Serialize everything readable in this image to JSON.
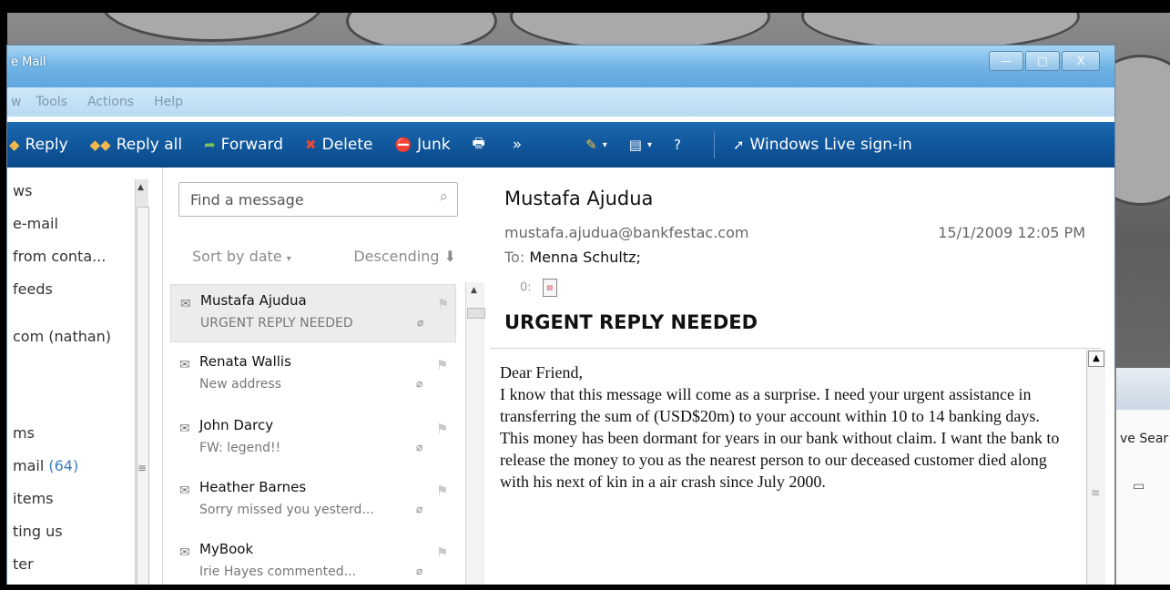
{
  "window": {
    "title": "e Mail",
    "controls": {
      "minimize": "—",
      "maximize": "□",
      "close": "X"
    }
  },
  "menu": [
    "w",
    "Tools",
    "Actions",
    "Help"
  ],
  "toolbar": {
    "reply": "Reply",
    "reply_all": "Reply all",
    "forward": "Forward",
    "delete": "Delete",
    "junk": "Junk",
    "more": "»",
    "signin": "Windows Live sign-in"
  },
  "folders": [
    {
      "label": "ws"
    },
    {
      "label": "e-mail"
    },
    {
      "label": "from conta..."
    },
    {
      "label": "feeds"
    },
    {
      "label": "com (nathan)"
    },
    {
      "label": "ms"
    },
    {
      "label": "mail",
      "count": "(64)"
    },
    {
      "label": "items"
    },
    {
      "label": "ting us"
    },
    {
      "label": "ter"
    }
  ],
  "list": {
    "search_placeholder": "Find a message",
    "sort_by": "Sort by date",
    "order": "Descending",
    "messages": [
      {
        "from": "Mustafa Ajudua",
        "subject": "URGENT REPLY NEEDED",
        "attachment": true,
        "selected": true
      },
      {
        "from": "Renata Wallis",
        "subject": "New address",
        "attachment": true
      },
      {
        "from": "John Darcy",
        "subject": "FW: legend!!",
        "attachment": true
      },
      {
        "from": "Heather Barnes",
        "subject": "Sorry missed you yesterd...",
        "attachment": true
      },
      {
        "from": "MyBook",
        "subject": "Irie Hayes commented...",
        "attachment": true
      }
    ]
  },
  "reading": {
    "from_name": "Mustafa Ajudua",
    "from_email": "mustafa.ajudua@bankfestac.com",
    "date": "15/1/2009 12:05 PM",
    "to_label": "To:",
    "to": "Menna Schultz;",
    "attachment_marker": "0:",
    "subject": "URGENT REPLY NEEDED",
    "body": "Dear Friend,\nI know that this message will come as a surprise.  I need your urgent assistance in transferring the sum of (USD$20m) to your account within 10 to 14 banking days.  This money has been dormant for years in our bank without claim.  I want the bank to release the  money to you as the nearest person to our deceased customer died along with his next of kin in a air crash since July 2000."
  },
  "background_window": {
    "text": "ve Sear"
  },
  "colors": {
    "toolbar": "#10579c",
    "titlebar": "#6eb2e4",
    "count": "#3c7fc1"
  }
}
